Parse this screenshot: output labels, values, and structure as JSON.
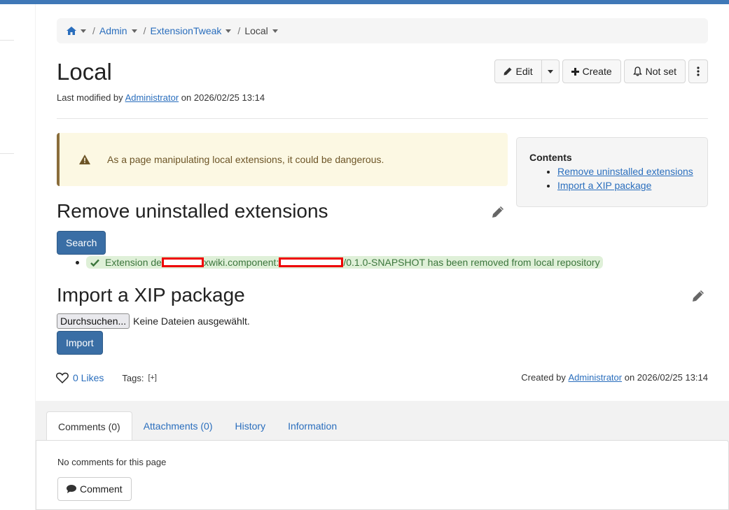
{
  "breadcrumb": {
    "items": [
      "Admin",
      "ExtensionTweak",
      "Local"
    ]
  },
  "page": {
    "title": "Local",
    "last_modified_prefix": "Last modified by",
    "last_modified_user": "Administrator",
    "last_modified_on": "on 2026/02/25 13:14"
  },
  "actions": {
    "edit": "Edit",
    "create": "Create",
    "notify": "Not set"
  },
  "warning": "As a page manipulating local extensions, it could be dangerous.",
  "toc": {
    "title": "Contents",
    "items": [
      "Remove uninstalled extensions",
      "Import a XIP package"
    ]
  },
  "remove_section": {
    "heading": "Remove uninstalled extensions",
    "search_label": "Search",
    "result_prefix": "Extension de",
    "result_middle": "xwiki.component:",
    "result_suffix": "/0.1.0-SNAPSHOT has been removed from local repository"
  },
  "import_section": {
    "heading": "Import a XIP package",
    "browse_label": "Durchsuchen...",
    "no_file": "Keine Dateien ausgewählt.",
    "import_label": "Import"
  },
  "footer": {
    "likes": "0 Likes",
    "tags_label": "Tags:",
    "tags_add": "[+]",
    "created_prefix": "Created by",
    "created_user": "Administrator",
    "created_on": "on 2026/02/25 13:14"
  },
  "tabs": [
    {
      "label": "Comments (0)"
    },
    {
      "label": "Attachments (0)"
    },
    {
      "label": "History"
    },
    {
      "label": "Information"
    }
  ],
  "comments": {
    "empty": "No comments for this page",
    "button": "Comment"
  },
  "colors": {
    "accent": "#3f78b7",
    "primary_button": "#3a6ea5",
    "link": "#2a6ebd",
    "warning_bg": "#fcf8e3",
    "success_bg": "#dff0d8"
  }
}
